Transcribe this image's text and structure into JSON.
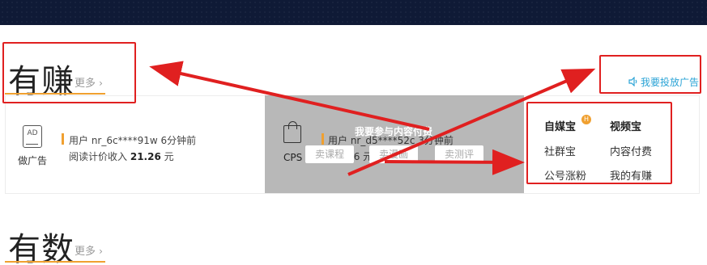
{
  "colors": {
    "topbar": "#0f1a36",
    "accent_orange": "#f0a030",
    "link_blue": "#2aa3d6",
    "annotation_red": "#e02020",
    "overlay_gray": "#a0a0a0"
  },
  "sections": [
    {
      "title": "有赚",
      "more_label": "更多"
    },
    {
      "title": "有数",
      "more_label": "更多"
    }
  ],
  "ad_promo_label": "我要投放广告",
  "ad_entry": {
    "icon_text": "AD",
    "label": "做广告"
  },
  "feed": {
    "line1": "用户  nr_6c****91w  6分钟前",
    "line2_prefix": "阅读计价收入",
    "line2_amount": "21.26",
    "line2_unit": "元"
  },
  "overlay": {
    "title": "我要参与内容付费",
    "cps_label": "CPS",
    "feed_line1": "用户  nr_d5****52c  3分钟前",
    "feed_line2": "11.16 元",
    "buttons": [
      "卖课程",
      "卖漫画",
      "卖测评"
    ]
  },
  "grid": [
    [
      "自媒宝",
      "视频宝"
    ],
    [
      "社群宝",
      "内容付费"
    ],
    [
      "公号涨粉",
      "我的有赚"
    ]
  ],
  "hot_badge": "H",
  "icons": {
    "more_chevron": "chevron-right-icon",
    "promo": "speaker-icon",
    "ad": "ad-icon",
    "cps": "shopping-bag-icon"
  }
}
